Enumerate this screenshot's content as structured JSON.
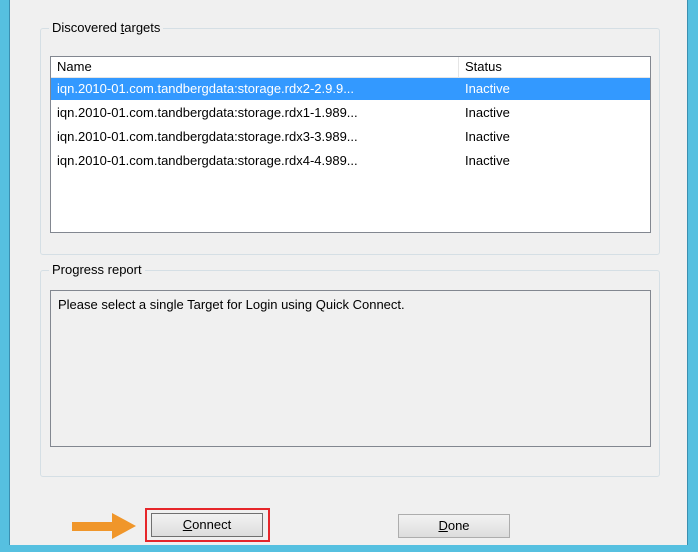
{
  "colors": {
    "frame": "#56c0e0",
    "selection": "#3399ff",
    "highlight_border": "#e6262a",
    "arrow": "#f0962a"
  },
  "targets_group": {
    "title_prefix": "Discovered ",
    "title_mnemonic": "t",
    "title_suffix": "argets",
    "columns": {
      "name": "Name",
      "status": "Status"
    },
    "rows": [
      {
        "name": "iqn.2010-01.com.tandbergdata:storage.rdx2-2.9.9...",
        "status": "Inactive"
      },
      {
        "name": "iqn.2010-01.com.tandbergdata:storage.rdx1-1.989...",
        "status": "Inactive"
      },
      {
        "name": "iqn.2010-01.com.tandbergdata:storage.rdx3-3.989...",
        "status": "Inactive"
      },
      {
        "name": "iqn.2010-01.com.tandbergdata:storage.rdx4-4.989...",
        "status": "Inactive"
      }
    ]
  },
  "progress_group": {
    "title": "Progress report",
    "message": "Please select a single Target for Login using Quick Connect."
  },
  "buttons": {
    "connect_mnemonic": "C",
    "connect_rest": "onnect",
    "done_mnemonic": "D",
    "done_rest": "one"
  },
  "annotation": {
    "arrow_icon": "arrow-right-icon"
  }
}
